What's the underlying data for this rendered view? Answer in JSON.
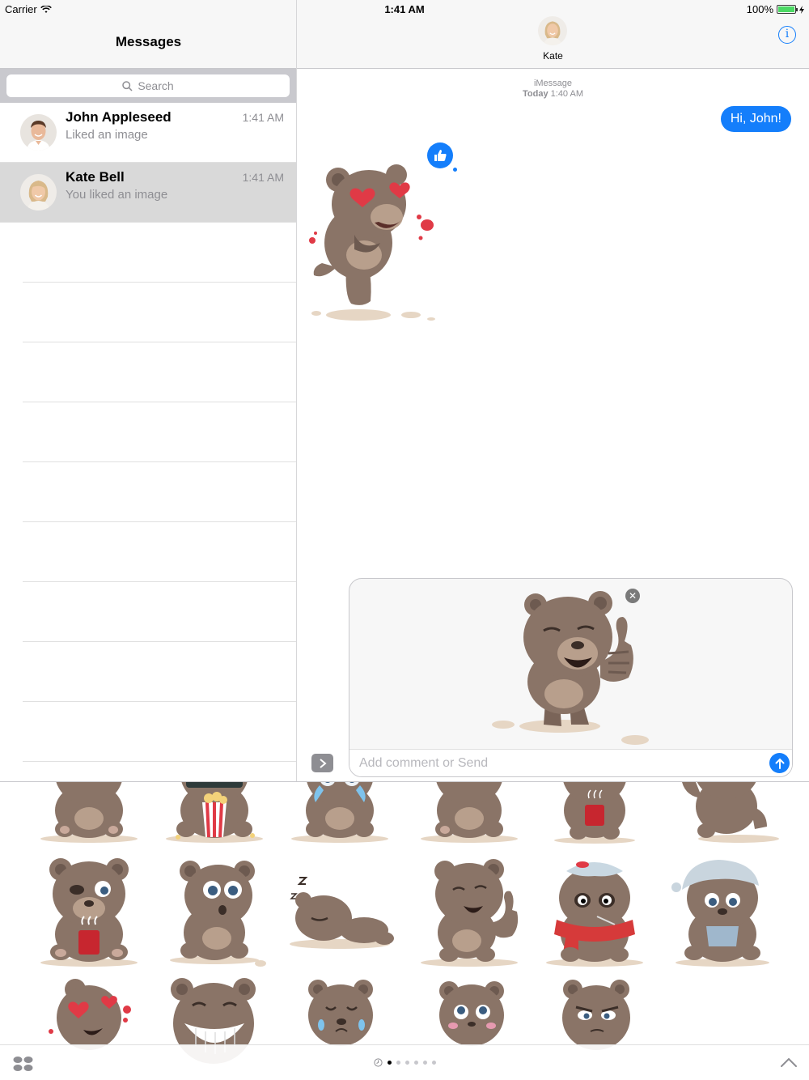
{
  "status_bar": {
    "carrier": "Carrier",
    "time": "1:41 AM",
    "battery": "100%"
  },
  "sidebar": {
    "title": "Messages",
    "search_placeholder": "Search",
    "conversations": [
      {
        "name": "John Appleseed",
        "preview": "Liked an image",
        "time": "1:41 AM",
        "selected": false
      },
      {
        "name": "Kate Bell",
        "preview": "You liked an image",
        "time": "1:41 AM",
        "selected": true
      }
    ]
  },
  "chat": {
    "contact_name": "Kate",
    "service_label": "iMessage",
    "timestamp_prefix": "Today",
    "timestamp_time": "1:40 AM",
    "outgoing_message": "Hi, John!",
    "tapback": "thumbs-up-icon"
  },
  "compose": {
    "placeholder": "Add comment or Send"
  },
  "drawer": {
    "stickers": [
      "bear-sitting",
      "bear-popcorn",
      "bear-crying",
      "bear-grumpy",
      "bear-coffee",
      "bear-dancing",
      "bear-coffee-sleepy",
      "bear-surprised",
      "bear-sleeping",
      "bear-thumbs-up",
      "bear-sick",
      "bear-cold",
      "bear-love",
      "bear-grin",
      "bear-sad",
      "bear-pleading",
      "bear-angry"
    ],
    "page_count": 6,
    "active_page": 0
  },
  "colors": {
    "accent": "#147efb",
    "bear_fur": "#8a7467",
    "bear_dark": "#6d5a50",
    "heart": "#e03a46"
  }
}
